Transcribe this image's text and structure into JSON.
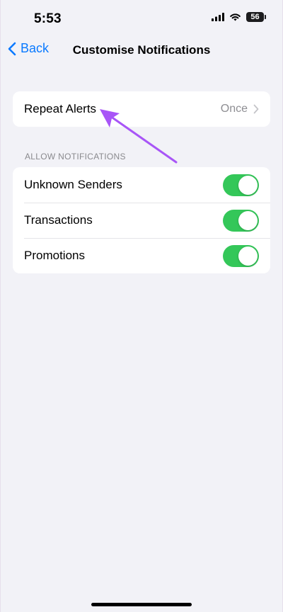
{
  "status_bar": {
    "time": "5:53",
    "battery_level": "56",
    "icons": [
      "cellular-signal-icon",
      "wifi-icon",
      "battery-icon"
    ]
  },
  "nav": {
    "back_label": "Back",
    "title": "Customise Notifications"
  },
  "repeat_group": {
    "label": "Repeat Alerts",
    "value": "Once"
  },
  "allow_section": {
    "header": "ALLOW NOTIFICATIONS",
    "items": [
      {
        "label": "Unknown Senders",
        "enabled": true
      },
      {
        "label": "Transactions",
        "enabled": true
      },
      {
        "label": "Promotions",
        "enabled": true
      }
    ]
  },
  "colors": {
    "accent": "#0a7aff",
    "toggle_on": "#34c759",
    "annotation": "#a855f7",
    "background": "#f2f2f7"
  }
}
